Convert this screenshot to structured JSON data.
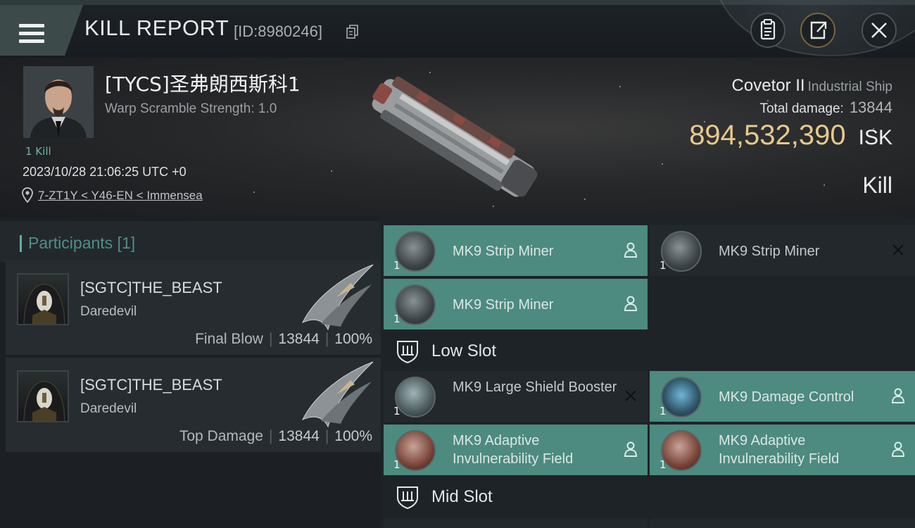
{
  "header": {
    "title": "KILL REPORT",
    "report_id": "[ID:8980246]",
    "buttons": [
      "clipboard-icon",
      "share-icon",
      "close-icon"
    ]
  },
  "victim": {
    "name": "[TYCS]圣弗朗西斯科1",
    "warp_scramble": "Warp Scramble Strength: 1.0",
    "kills": "1 Kill",
    "timestamp": "2023/10/28 21:06:25 UTC +0",
    "location": "7-ZT1Y < Y46-EN < Immensea",
    "ship_name": "Covetor II",
    "ship_class": "Industrial Ship",
    "total_damage_label": "Total damage:",
    "total_damage": "13844",
    "isk_value": "894,532,390",
    "isk_unit": "ISK",
    "result": "Kill"
  },
  "participants": {
    "heading": "Participants [1]",
    "rows": [
      {
        "name": "[SGTC]THE_BEAST",
        "ship": "Daredevil",
        "role": "Final Blow",
        "damage": "13844",
        "percent": "100%"
      },
      {
        "name": "[SGTC]THE_BEAST",
        "ship": "Daredevil",
        "role": "Top Damage",
        "damage": "13844",
        "percent": "100%"
      }
    ]
  },
  "fitting": {
    "high": [
      {
        "name": "MK9 Strip Miner",
        "qty": "1",
        "state": "fitted",
        "icon": "strip-miner-icon"
      },
      {
        "name": "MK9 Strip Miner",
        "qty": "1",
        "state": "destroyed",
        "icon": "strip-miner-icon"
      },
      {
        "name": "MK9 Strip Miner",
        "qty": "1",
        "state": "fitted",
        "icon": "strip-miner-icon"
      }
    ],
    "low_heading": "Low Slot",
    "low": [
      {
        "name": "MK9 Large Shield Booster",
        "qty": "1",
        "state": "destroyed",
        "icon": "shield-booster-icon"
      },
      {
        "name": "MK9 Damage Control",
        "qty": "1",
        "state": "fitted",
        "icon": "damage-control-icon"
      },
      {
        "name": "MK9 Adaptive Invulnerability Field",
        "qty": "1",
        "state": "fitted",
        "icon": "invulnerability-field-icon"
      },
      {
        "name": "MK9 Adaptive Invulnerability Field",
        "qty": "1",
        "state": "fitted",
        "icon": "invulnerability-field-icon"
      }
    ],
    "mid_heading": "Mid Slot"
  },
  "colors": {
    "accent": "#4d8a80",
    "isk_gold": "#e6c98c",
    "panel": "#272c31"
  }
}
